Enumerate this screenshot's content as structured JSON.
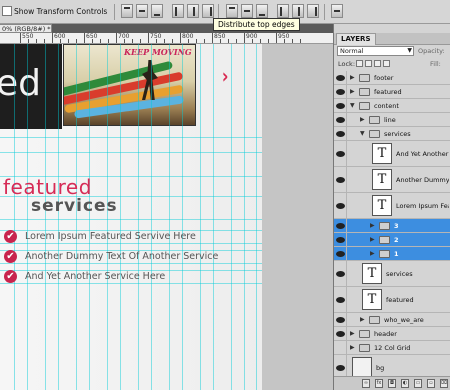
{
  "options_bar": {
    "show_transform_controls_label": "Show Transform Controls",
    "tooltip": "Distribute top edges"
  },
  "document": {
    "tab_title": "0% (RGB/8#) *",
    "ruler_numbers": [
      "550",
      "600",
      "650",
      "700",
      "750",
      "800",
      "850",
      "900",
      "950"
    ],
    "canvas": {
      "hero_text": "ed",
      "hero_image_caption": "KEEP MOVING",
      "next_arrow": "›",
      "featured_heading": "featured",
      "services_heading": "services",
      "services_list": [
        "Lorem Ipsum Featured Servive Here",
        "Another Dummy Text Of Another Service",
        "And Yet Another Service Here"
      ],
      "check_glyph": "✔"
    }
  },
  "layers_panel": {
    "tab_label": "LAYERS",
    "blend_mode": "Normal",
    "opacity_label": "Opacity:",
    "lock_label": "Lock:",
    "fill_label": "Fill:",
    "layers": [
      {
        "name": "footer",
        "kind": "group",
        "depth": 0,
        "expanded": false,
        "visible": true,
        "selected": false
      },
      {
        "name": "featured",
        "kind": "group",
        "depth": 0,
        "expanded": false,
        "visible": true,
        "selected": false
      },
      {
        "name": "content",
        "kind": "group",
        "depth": 0,
        "expanded": true,
        "visible": true,
        "selected": false
      },
      {
        "name": "line",
        "kind": "group",
        "depth": 1,
        "expanded": false,
        "visible": true,
        "selected": false
      },
      {
        "name": "services",
        "kind": "group",
        "depth": 1,
        "expanded": true,
        "visible": true,
        "selected": false
      },
      {
        "name": "And Yet Another Ser...",
        "kind": "text",
        "depth": 2,
        "visible": true,
        "selected": false
      },
      {
        "name": "Another Dummy Text...",
        "kind": "text",
        "depth": 2,
        "visible": true,
        "selected": false
      },
      {
        "name": "Lorem Ipsum Feature...",
        "kind": "text",
        "depth": 2,
        "visible": true,
        "selected": false
      },
      {
        "name": "3",
        "kind": "group",
        "depth": 2,
        "expanded": false,
        "visible": true,
        "selected": true
      },
      {
        "name": "2",
        "kind": "group",
        "depth": 2,
        "expanded": false,
        "visible": true,
        "selected": true
      },
      {
        "name": "1",
        "kind": "group",
        "depth": 2,
        "expanded": false,
        "visible": true,
        "selected": true
      },
      {
        "name": "services",
        "kind": "text",
        "depth": 1,
        "visible": true,
        "selected": false
      },
      {
        "name": "featured",
        "kind": "text",
        "depth": 1,
        "visible": true,
        "selected": false
      },
      {
        "name": "who_we_are",
        "kind": "group",
        "depth": 1,
        "expanded": false,
        "visible": true,
        "selected": false
      },
      {
        "name": "header",
        "kind": "group",
        "depth": 0,
        "expanded": false,
        "visible": true,
        "selected": false
      },
      {
        "name": "12 Col Grid",
        "kind": "group",
        "depth": 0,
        "expanded": false,
        "visible": false,
        "selected": false
      },
      {
        "name": "bg",
        "kind": "image",
        "depth": 0,
        "visible": true,
        "selected": false
      }
    ],
    "footer_icons": [
      "link-icon",
      "fx-icon",
      "mask-icon",
      "adjustment-icon",
      "new-group-icon",
      "new-layer-icon",
      "trash-icon"
    ],
    "footer_glyphs": [
      "∞",
      "fx",
      "◘",
      "◐",
      "▭",
      "▫",
      "⌧"
    ]
  },
  "colors": {
    "accent": "#d62b56",
    "selection": "#3d8ee0",
    "guide": "#00cdd7"
  }
}
